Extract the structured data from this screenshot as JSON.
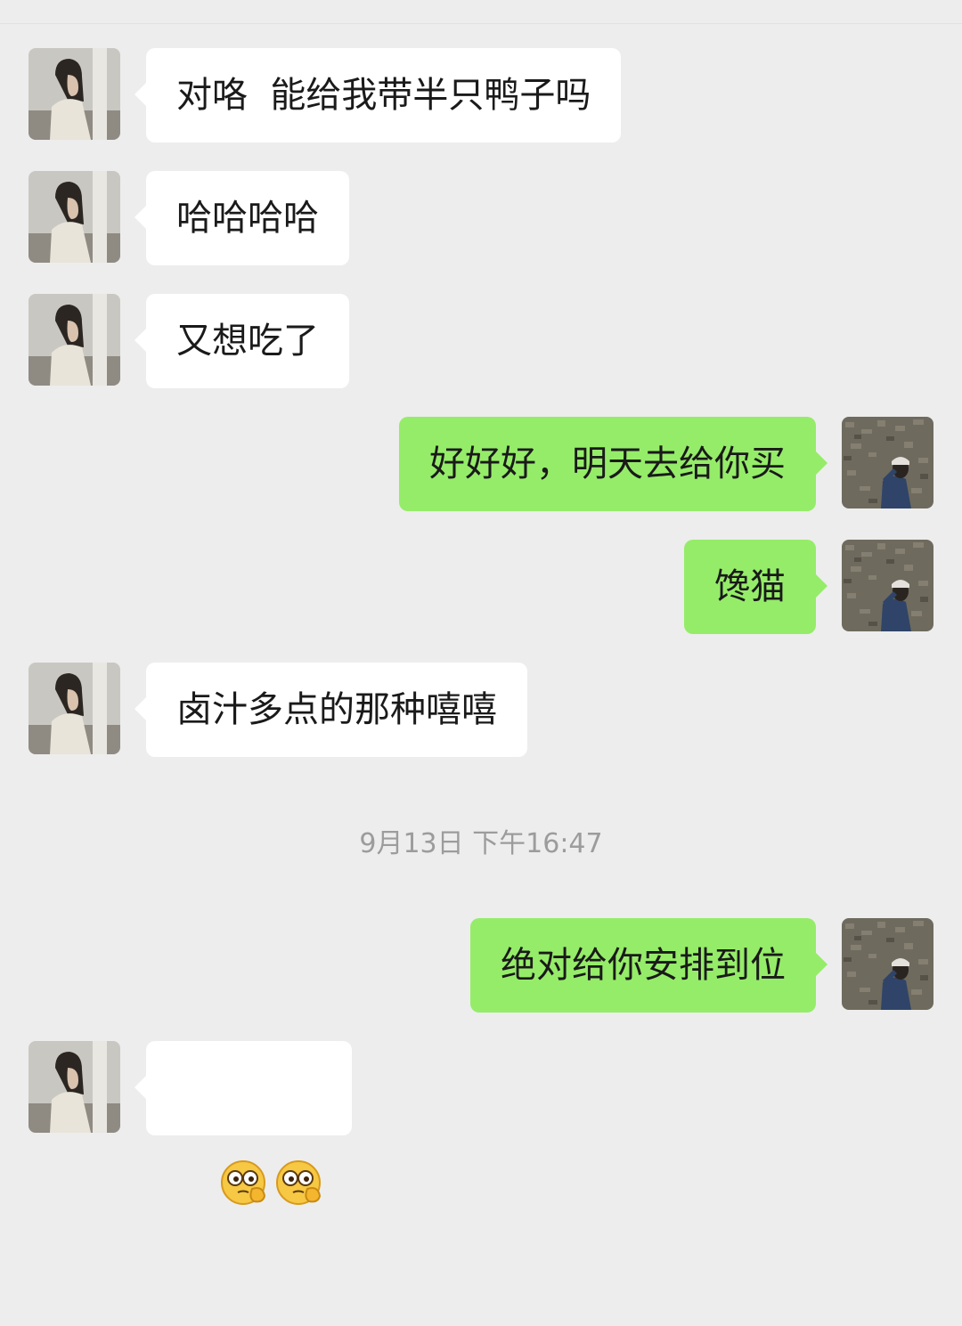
{
  "chat": {
    "timestamp": "9月13日 下午16:47",
    "messages": [
      {
        "side": "left",
        "text": "对咯  能给我带半只鸭子吗"
      },
      {
        "side": "left",
        "text": "哈哈哈哈"
      },
      {
        "side": "left",
        "text": "又想吃了"
      },
      {
        "side": "right",
        "text": "好好好，明天去给你买"
      },
      {
        "side": "right",
        "text": "馋猫"
      },
      {
        "side": "left",
        "text": "卤汁多点的那种嘻嘻"
      },
      {
        "side": "right",
        "text": "绝对给你安排到位"
      },
      {
        "side": "left",
        "emojis": [
          "thinking-face-emoji",
          "thinking-face-emoji"
        ]
      }
    ]
  },
  "colors": {
    "background": "#ededed",
    "incoming_bubble": "#ffffff",
    "outgoing_bubble": "#95ec69",
    "timestamp_text": "#9c9c9c"
  }
}
